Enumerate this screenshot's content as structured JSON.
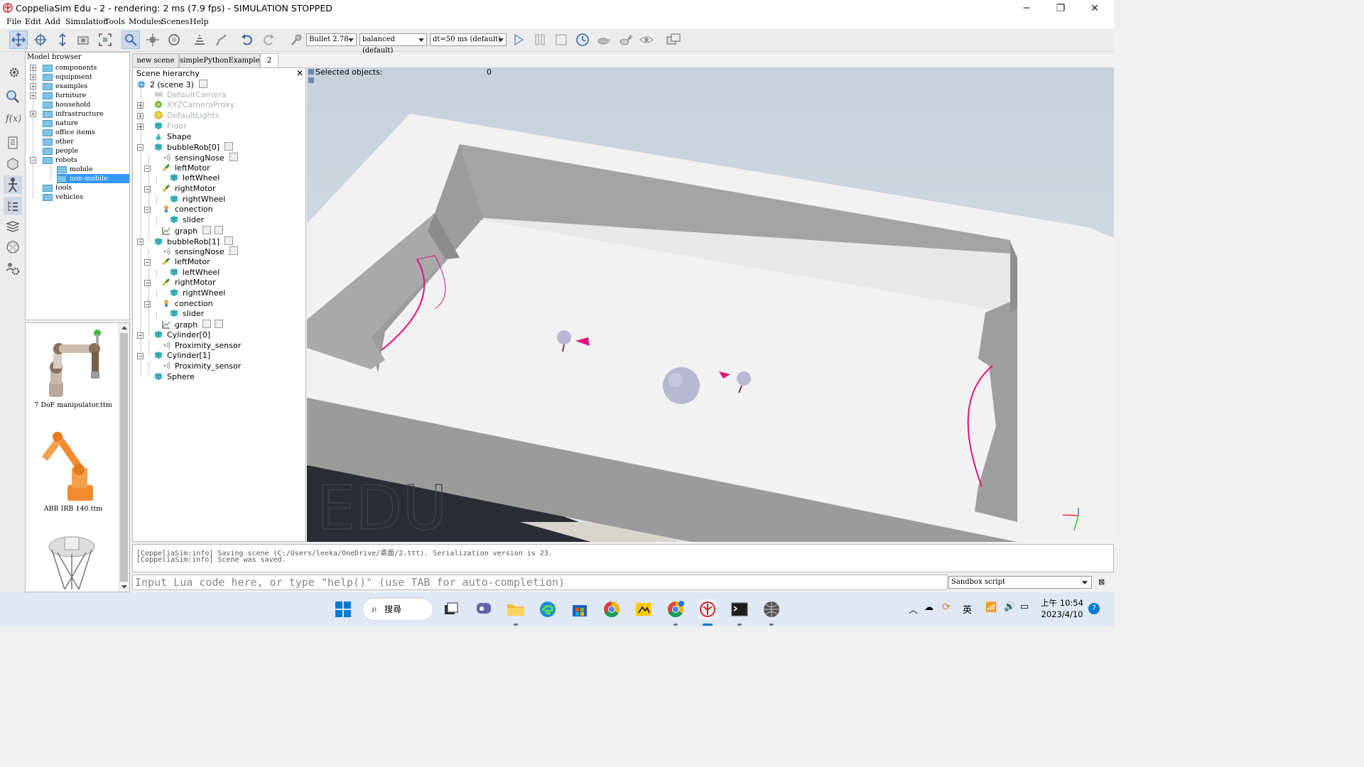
{
  "window": {
    "title": "CoppeliaSim Edu - 2 - rendering: 2 ms (7.9 fps) - SIMULATION STOPPED",
    "controls": [
      "─",
      "❐",
      "✕"
    ]
  },
  "menu": [
    "File",
    "Edit",
    "Add",
    "Simulation",
    "Tools",
    "Modules",
    "Scenes",
    "Help"
  ],
  "toolbar": {
    "engine": "Bullet 2.78",
    "accuracy": "balanced (default)",
    "timestep": "dt=50 ms (default)"
  },
  "model_browser": {
    "title": "Model browser",
    "folders": [
      {
        "label": "components",
        "expandable": true
      },
      {
        "label": "equipment",
        "expandable": true
      },
      {
        "label": "examples",
        "expandable": true
      },
      {
        "label": "furniture",
        "expandable": true
      },
      {
        "label": "household",
        "expandable": false
      },
      {
        "label": "infrastructure",
        "expandable": true
      },
      {
        "label": "nature",
        "expandable": false
      },
      {
        "label": "office items",
        "expandable": false
      },
      {
        "label": "other",
        "expandable": false
      },
      {
        "label": "people",
        "expandable": false
      },
      {
        "label": "robots",
        "expandable": true,
        "expanded": true
      },
      {
        "label": "mobile",
        "child": true
      },
      {
        "label": "non-mobile",
        "child": true,
        "selected": true
      },
      {
        "label": "tools",
        "expandable": false
      },
      {
        "label": "vehicles",
        "expandable": false
      }
    ],
    "thumbnails": [
      "7 DoF manipulator.ttm",
      "ABB IRB 140.ttm"
    ]
  },
  "tabs": [
    "new scene",
    "simplePythonExample",
    "2"
  ],
  "hierarchy": {
    "title": "Scene hierarchy",
    "items": [
      {
        "label": "2 (scene 3)",
        "icon": "scene",
        "level": 0
      },
      {
        "label": "DefaultCamera",
        "icon": "camera",
        "level": 1,
        "dim": true
      },
      {
        "label": "XYZCameraProxy",
        "icon": "dummy",
        "level": 1,
        "dim": true
      },
      {
        "label": "DefaultLights",
        "icon": "light",
        "level": 1,
        "dim": true
      },
      {
        "label": "Floor",
        "icon": "shape",
        "level": 1,
        "dim": true
      },
      {
        "label": "Shape",
        "icon": "shape-cone",
        "level": 1
      },
      {
        "label": "bubbleRob[0]",
        "icon": "shape",
        "level": 1
      },
      {
        "label": "sensingNose",
        "icon": "sensor",
        "level": 2
      },
      {
        "label": "leftMotor",
        "icon": "joint",
        "level": 2
      },
      {
        "label": "leftWheel",
        "icon": "shape",
        "level": 3
      },
      {
        "label": "rightMotor",
        "icon": "joint",
        "level": 2
      },
      {
        "label": "rightWheel",
        "icon": "shape",
        "level": 3
      },
      {
        "label": "conection",
        "icon": "force",
        "level": 2
      },
      {
        "label": "slider",
        "icon": "shape",
        "level": 3
      },
      {
        "label": "graph",
        "icon": "graph",
        "level": 2
      },
      {
        "label": "bubbleRob[1]",
        "icon": "shape",
        "level": 1
      },
      {
        "label": "sensingNose",
        "icon": "sensor",
        "level": 2
      },
      {
        "label": "leftMotor",
        "icon": "joint",
        "level": 2
      },
      {
        "label": "leftWheel",
        "icon": "shape",
        "level": 3
      },
      {
        "label": "rightMotor",
        "icon": "joint",
        "level": 2
      },
      {
        "label": "rightWheel",
        "icon": "shape",
        "level": 3
      },
      {
        "label": "conection",
        "icon": "force",
        "level": 2
      },
      {
        "label": "slider",
        "icon": "shape",
        "level": 3
      },
      {
        "label": "graph",
        "icon": "graph",
        "level": 2
      },
      {
        "label": "Cylinder[0]",
        "icon": "shape",
        "level": 1
      },
      {
        "label": "Proximity_sensor",
        "icon": "sensor",
        "level": 2
      },
      {
        "label": "Cylinder[1]",
        "icon": "shape",
        "level": 1
      },
      {
        "label": "Proximity_sensor",
        "icon": "sensor",
        "level": 2
      },
      {
        "label": "Sphere",
        "icon": "shape",
        "level": 1
      }
    ]
  },
  "viewport": {
    "selected_label": "Selected objects:",
    "selected_count": "0",
    "watermark": "EDU"
  },
  "console": {
    "lines": [
      "[CoppeliaSim:info] Saving scene (C:/Users/leeka/OneDrive/桌面/2.ttt). Serialization version is 23.",
      "[CoppeliaSim:info] Scene was saved."
    ],
    "input_placeholder": "Input Lua code here, or type \"help()\" (use TAB for auto-completion)",
    "script_select": "Sandbox script"
  },
  "taskbar": {
    "search_label": "搜尋",
    "tray_lang": "英",
    "clock_time": "上午 10:54",
    "clock_date": "2023/4/10",
    "notification_count": "7",
    "colors": {
      "accent": "#0078d4",
      "selection": "#3399ff",
      "pink": "#e2127a"
    }
  }
}
